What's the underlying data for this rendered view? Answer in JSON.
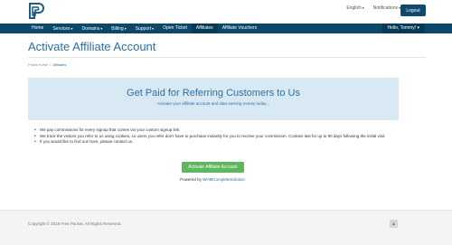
{
  "header": {
    "language": "English",
    "notifications": "Notifications",
    "logout": "Logout"
  },
  "nav": {
    "items": [
      {
        "label": "Home",
        "dropdown": false
      },
      {
        "label": "Services",
        "dropdown": true
      },
      {
        "label": "Domains",
        "dropdown": true
      },
      {
        "label": "Billing",
        "dropdown": true
      },
      {
        "label": "Support",
        "dropdown": true
      },
      {
        "label": "Open Ticket",
        "dropdown": false
      },
      {
        "label": "Affiliates",
        "dropdown": false,
        "active": true
      },
      {
        "label": "Affiliate Vouchers",
        "dropdown": false
      }
    ],
    "user": "Hello, Tommy!",
    "caret": "▾"
  },
  "page": {
    "title": "Activate Affiliate Account",
    "breadcrumb": {
      "home": "Portal Home",
      "separator": "/",
      "current": "Affiliates"
    }
  },
  "hero": {
    "title": "Get Paid for Referring Customers to Us",
    "subtitle": "Activate your affiliate account and start earning money today..."
  },
  "bullets": [
    "We pay commissions for every signup that comes via your custom signup link.",
    "We track the visitors you refer to us using cookies, so users you refer don't have to purchase instantly for you to receive your commission. Cookies last for up to 90 days following the initial visit.",
    "If you would like to find out more, please contact us."
  ],
  "actions": {
    "activate": "Activate Affiliate Account"
  },
  "powered": {
    "prefix": "Powered by ",
    "brand": "WHMCompleteSolution"
  },
  "footer": {
    "copyright": "Copyright © 2019 Free Packet. All Rights Reserved.",
    "back_to_top": "▲"
  },
  "colors": {
    "nav": "#0b4869",
    "accent": "#2a6ea7",
    "success": "#5cb85c",
    "hero_bg": "#d8e9f3"
  }
}
